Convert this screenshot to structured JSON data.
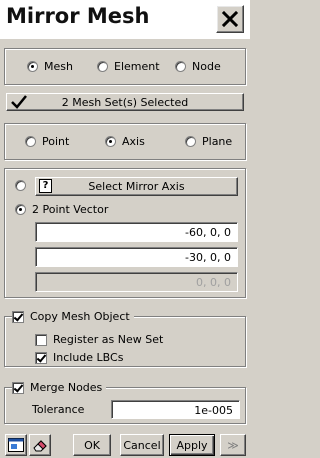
{
  "window": {
    "title": "Mirror Mesh"
  },
  "entity_type": {
    "options": [
      {
        "label": "Mesh",
        "selected": true
      },
      {
        "label": "Element",
        "selected": false
      },
      {
        "label": "Node",
        "selected": false
      }
    ]
  },
  "selection_button": {
    "label": "2 Mesh Set(s) Selected"
  },
  "mirror_type": {
    "options": [
      {
        "label": "Point",
        "selected": false
      },
      {
        "label": "Axis",
        "selected": true
      },
      {
        "label": "Plane",
        "selected": false
      }
    ]
  },
  "mirror_axis": {
    "select_button_label": "Select Mirror Axis",
    "select_selected": false,
    "two_point_label": "2 Point Vector",
    "two_point_selected": true,
    "fields": [
      "-60, 0, 0",
      "-30, 0, 0",
      "0, 0, 0"
    ]
  },
  "copy_mesh": {
    "label": "Copy Mesh Object",
    "checked": true,
    "register_label": "Register as New Set",
    "register_checked": false,
    "include_lbcs_label": "Include LBCs",
    "include_lbcs_checked": true
  },
  "merge_nodes": {
    "label": "Merge Nodes",
    "checked": true,
    "tolerance_label": "Tolerance",
    "tolerance_value": "1e-005"
  },
  "footer": {
    "ok_label": "OK",
    "cancel_label": "Cancel",
    "apply_label": "Apply",
    "more_label": "≫"
  }
}
